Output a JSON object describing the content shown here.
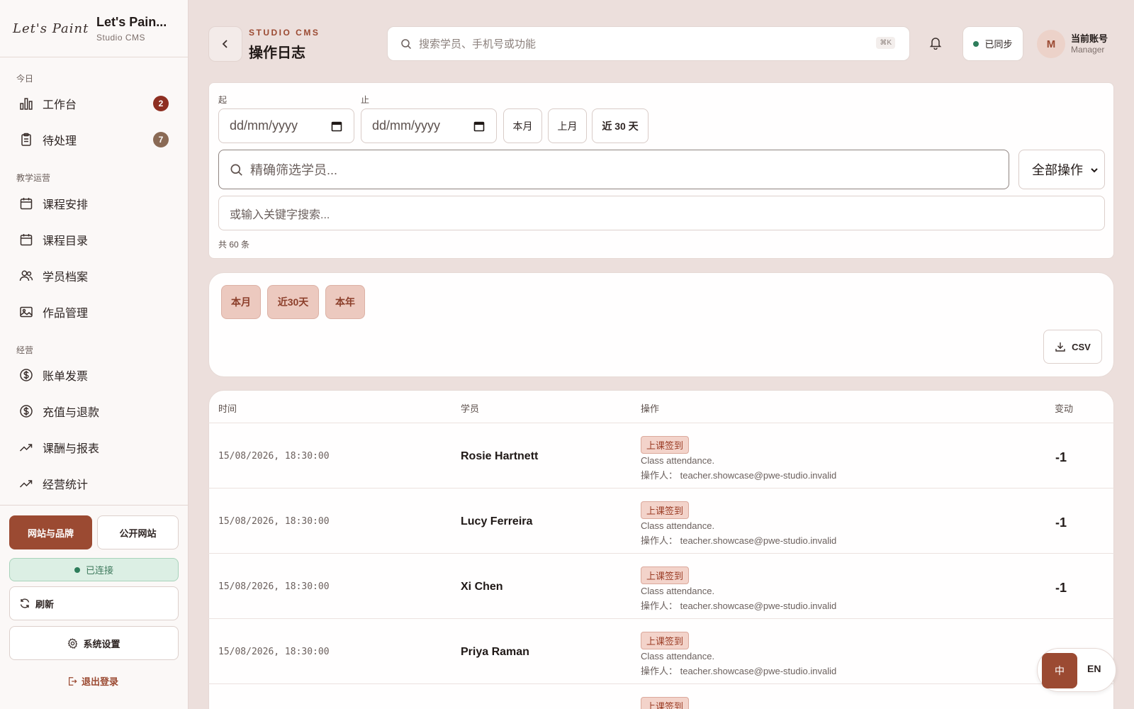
{
  "brand": {
    "logo": "Let's Paint",
    "title": "Let's Pain...",
    "subtitle": "Studio CMS"
  },
  "sidebar": {
    "sections": [
      {
        "label": "今日",
        "items": [
          {
            "label": "工作台",
            "icon": "bar-chart-icon",
            "badge": "2"
          },
          {
            "label": "待处理",
            "icon": "clipboard-icon",
            "badge": "7"
          }
        ]
      },
      {
        "label": "教学运营",
        "items": [
          {
            "label": "课程安排",
            "icon": "calendar-icon"
          },
          {
            "label": "课程目录",
            "icon": "calendar-icon"
          },
          {
            "label": "学员档案",
            "icon": "users-icon"
          },
          {
            "label": "作品管理",
            "icon": "image-icon"
          }
        ]
      },
      {
        "label": "经营",
        "items": [
          {
            "label": "账单发票",
            "icon": "dollar-icon"
          },
          {
            "label": "充值与退款",
            "icon": "dollar-icon"
          },
          {
            "label": "课酬与报表",
            "icon": "trend-icon"
          },
          {
            "label": "经营统计",
            "icon": "trend-icon"
          }
        ]
      }
    ],
    "website_brand": "网站与品牌",
    "public_site": "公开网站",
    "connected": "已连接",
    "refresh": "刷新",
    "settings": "系统设置",
    "logout": "退出登录"
  },
  "header": {
    "eyebrow": "STUDIO CMS",
    "title": "操作日志",
    "search_placeholder": "搜索学员、手机号或功能",
    "shortcut": "⌘K",
    "sync": "已同步",
    "avatar": "M",
    "account_name": "当前账号",
    "account_role": "Manager"
  },
  "filters": {
    "from_label": "起",
    "to_label": "止",
    "date_placeholder": "dd/mm/yyyy",
    "quick": [
      "本月",
      "上月",
      "近 30 天"
    ],
    "student_placeholder": "精确筛选学员...",
    "action_select": "全部操作",
    "keyword_placeholder": "或输入关键字搜索...",
    "count": "共 60 条"
  },
  "chips": [
    "本月",
    "近30天",
    "本年"
  ],
  "csv_label": "CSV",
  "table": {
    "headers": [
      "时间",
      "学员",
      "操作",
      "变动"
    ],
    "rows": [
      {
        "time": "15/08/2026, 18:30:00",
        "student": "Rosie Hartnett",
        "tag": "上课签到",
        "note": "Class attendance.",
        "operator": "操作人： teacher.showcase@pwe-studio.invalid",
        "delta": "-1"
      },
      {
        "time": "15/08/2026, 18:30:00",
        "student": "Lucy Ferreira",
        "tag": "上课签到",
        "note": "Class attendance.",
        "operator": "操作人： teacher.showcase@pwe-studio.invalid",
        "delta": "-1"
      },
      {
        "time": "15/08/2026, 18:30:00",
        "student": "Xi Chen",
        "tag": "上课签到",
        "note": "Class attendance.",
        "operator": "操作人： teacher.showcase@pwe-studio.invalid",
        "delta": "-1"
      },
      {
        "time": "15/08/2026, 18:30:00",
        "student": "Priya Raman",
        "tag": "上课签到",
        "note": "Class attendance.",
        "operator": "操作人： teacher.showcase@pwe-studio.invalid",
        "delta": ""
      },
      {
        "time": "",
        "student": "",
        "tag": "上课签到",
        "note": "",
        "operator": "",
        "delta": ""
      }
    ]
  },
  "lang": {
    "zh": "中",
    "en": "EN"
  },
  "colors": {
    "accent": "#9b4a32",
    "badge_red": "#8e2f22",
    "badge_brown": "#8a6a55",
    "connected_bg": "#dcefe4"
  }
}
